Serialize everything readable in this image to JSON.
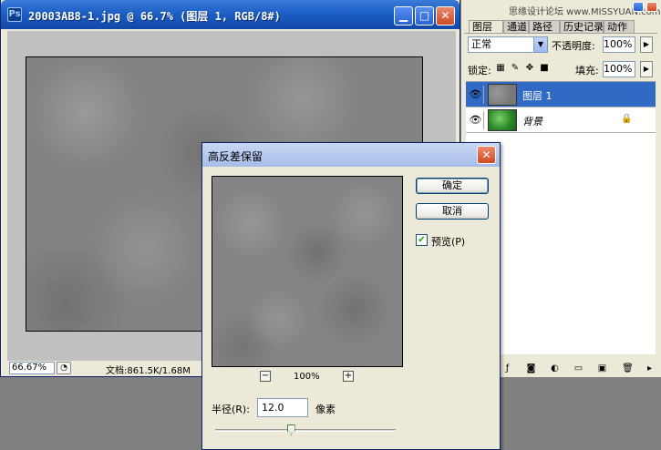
{
  "document_window": {
    "title": "20003AB8-1.jpg @ 66.7% (图层 1, RGB/8#)",
    "app_icon_glyph": "Ps",
    "minimize_glyph": "▁",
    "maximize_glyph": "□",
    "close_glyph": "✕",
    "status": {
      "zoom": "66.67%",
      "menu_glyph": "◔",
      "doc_info": "文档:861.5K/1.68M"
    }
  },
  "layers_panel": {
    "watermark": "思缘设计论坛 www.MISSYUAN.com",
    "tabs": [
      "图层",
      "通道",
      "路径",
      "历史记录",
      "动作"
    ],
    "blend_mode": "正常",
    "opacity_label": "不透明度:",
    "opacity_value": "100%",
    "lock_label": "锁定:",
    "fill_label": "填充:",
    "fill_value": "100%",
    "layers": [
      {
        "name": "图层 1",
        "selected": true
      },
      {
        "name": "背景",
        "selected": false,
        "locked": true
      }
    ],
    "footer_icons": [
      "link-icon",
      "layer-style-icon",
      "mask-icon",
      "adjustment-icon",
      "group-icon",
      "new-layer-icon",
      "trash-icon"
    ]
  },
  "dialog": {
    "title": "高反差保留",
    "ok_label": "确定",
    "cancel_label": "取消",
    "preview_label": "预览(P)",
    "preview_checked": true,
    "zoom_out_glyph": "−",
    "zoom_in_glyph": "+",
    "zoom_percent": "100%",
    "radius_label": "半径(R):",
    "radius_value": "12.0",
    "unit_label": "像素",
    "slider_fraction": 0.42
  },
  "colors": {
    "titlebar_blue": "#1c5fc6",
    "selection_blue": "#316ac5",
    "window_face": "#ece9d8",
    "workspace_gray": "#808080"
  }
}
